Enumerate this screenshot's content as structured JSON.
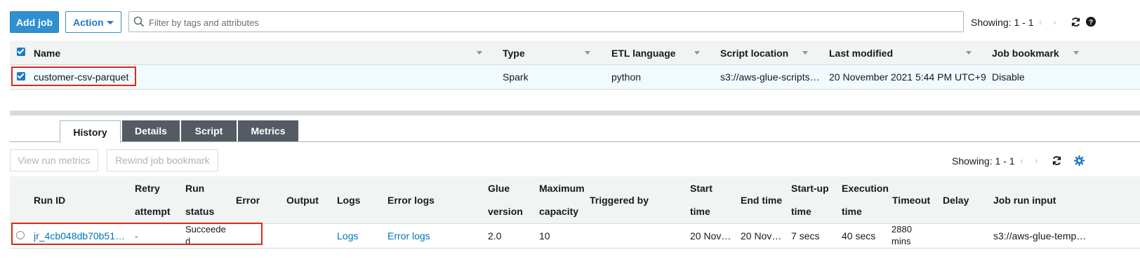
{
  "toolbar": {
    "add_job": "Add job",
    "action": "Action",
    "search_placeholder": "Filter by tags and attributes",
    "showing": "Showing: 1 - 1"
  },
  "jobs_table": {
    "headers": {
      "name": "Name",
      "type": "Type",
      "etl_language": "ETL language",
      "script_location": "Script location",
      "last_modified": "Last modified",
      "job_bookmark": "Job bookmark"
    },
    "row": {
      "name": "customer-csv-parquet",
      "type": "Spark",
      "etl_language": "python",
      "script_location": "s3://aws-glue-scripts…",
      "last_modified": "20 November 2021 5:44 PM UTC+9",
      "job_bookmark": "Disable"
    }
  },
  "tabs": [
    "History",
    "Details",
    "Script",
    "Metrics"
  ],
  "history": {
    "view_run_metrics": "View run metrics",
    "rewind_job_bookmark": "Rewind job bookmark",
    "showing": "Showing: 1 - 1",
    "headers": {
      "run_id": "Run ID",
      "retry_1": "Retry",
      "retry_2": "attempt",
      "run_status_1": "Run",
      "run_status_2": "status",
      "error": "Error",
      "output": "Output",
      "logs": "Logs",
      "error_logs": "Error logs",
      "glue_1": "Glue",
      "glue_2": "version",
      "max_1": "Maximum",
      "max_2": "capacity",
      "triggered_by": "Triggered by",
      "start_1": "Start",
      "start_2": "time",
      "end_time": "End time",
      "startup_1": "Start-up",
      "startup_2": "time",
      "exec_1": "Execution",
      "exec_2": "time",
      "timeout": "Timeout",
      "delay": "Delay",
      "job_run_input": "Job run input"
    },
    "row": {
      "run_id": "jr_4cb048db70b51…",
      "retry_attempt": "-",
      "run_status_1": "Succeede",
      "run_status_2": "d",
      "logs": "Logs",
      "error_logs": "Error logs",
      "glue_version": "2.0",
      "max_capacity": "10",
      "start_time": "20 Nov…",
      "end_time": "20 Nov…",
      "startup_time": "7 secs",
      "execution_time": "40 secs",
      "timeout_1": "2880",
      "timeout_2": "mins",
      "job_run_input": "s3://aws-glue-temp…"
    }
  },
  "colors": {
    "primary": "#2f8fd1",
    "link": "#0073bb",
    "highlight": "#e0271a",
    "selected_row": "#f1faff"
  }
}
